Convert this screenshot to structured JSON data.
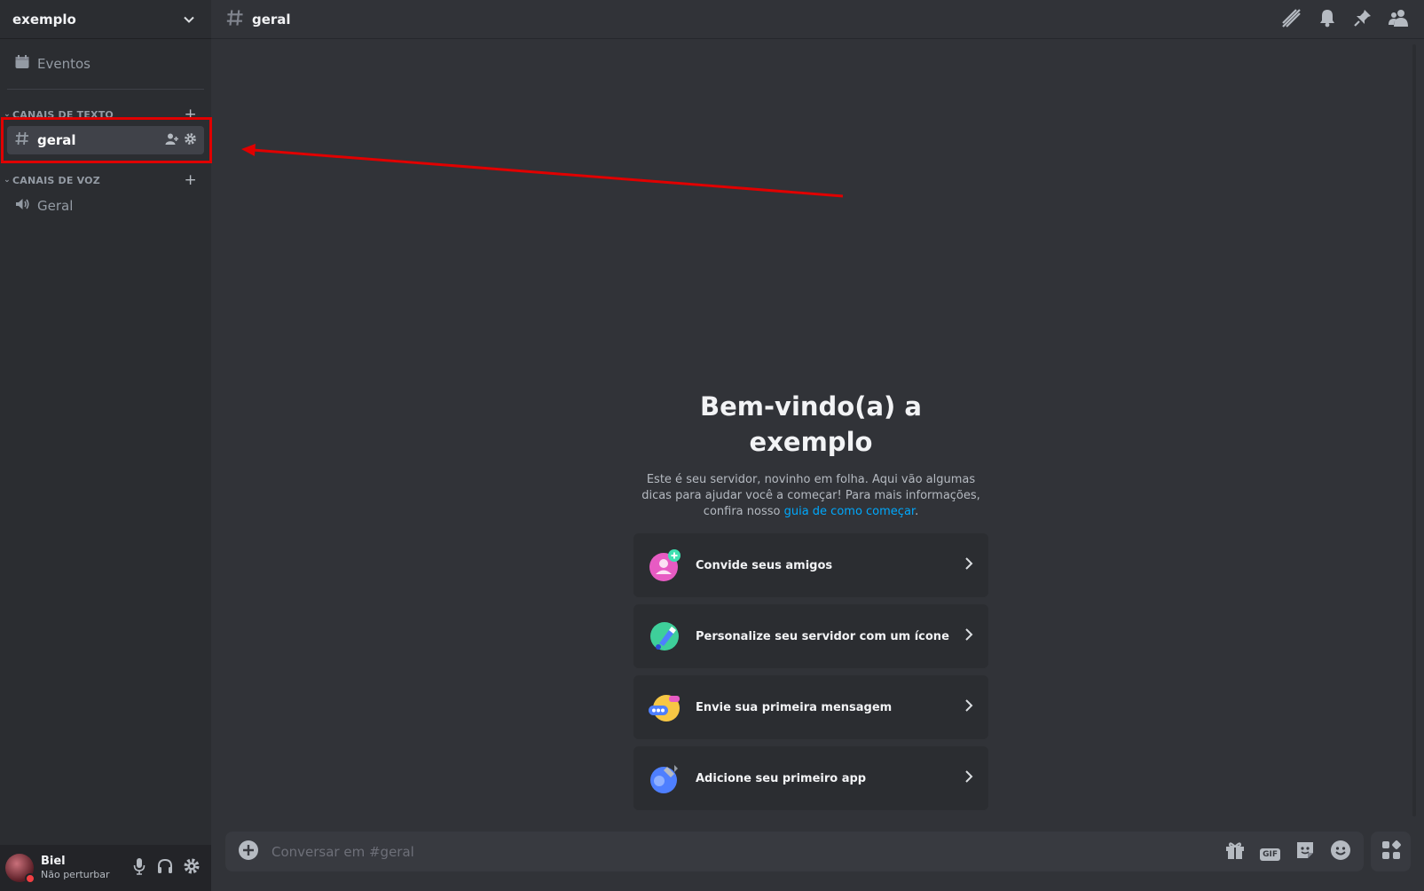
{
  "server": {
    "name": "exemplo"
  },
  "sidebar": {
    "events_label": "Eventos",
    "text_category": "CANAIS DE TEXTO",
    "voice_category": "CANAIS DE VOZ",
    "text_channel": "geral",
    "voice_channel": "Geral"
  },
  "user": {
    "name": "Biel",
    "status": "Não perturbar"
  },
  "topbar": {
    "channel": "geral"
  },
  "welcome": {
    "title_line1": "Bem-vindo(a) a",
    "title_line2": "exemplo",
    "desc": "Este é seu servidor, novinho em folha. Aqui vão algumas dicas para ajudar você a começar! Para mais informações, confira nosso ",
    "link": "guia de como começar",
    "desc_end": "."
  },
  "cards": [
    {
      "label": "Convide seus amigos",
      "icon": "invite-icon"
    },
    {
      "label": "Personalize seu servidor com um ícone",
      "icon": "customize-icon"
    },
    {
      "label": "Envie sua primeira mensagem",
      "icon": "message-icon"
    },
    {
      "label": "Adicione seu primeiro app",
      "icon": "app-icon"
    }
  ],
  "composer": {
    "placeholder": "Conversar em #geral",
    "gif_label": "GIF"
  },
  "colors": {
    "accent_link": "#00a8fc",
    "highlight": "#e00000",
    "dnd": "#f23f43"
  }
}
